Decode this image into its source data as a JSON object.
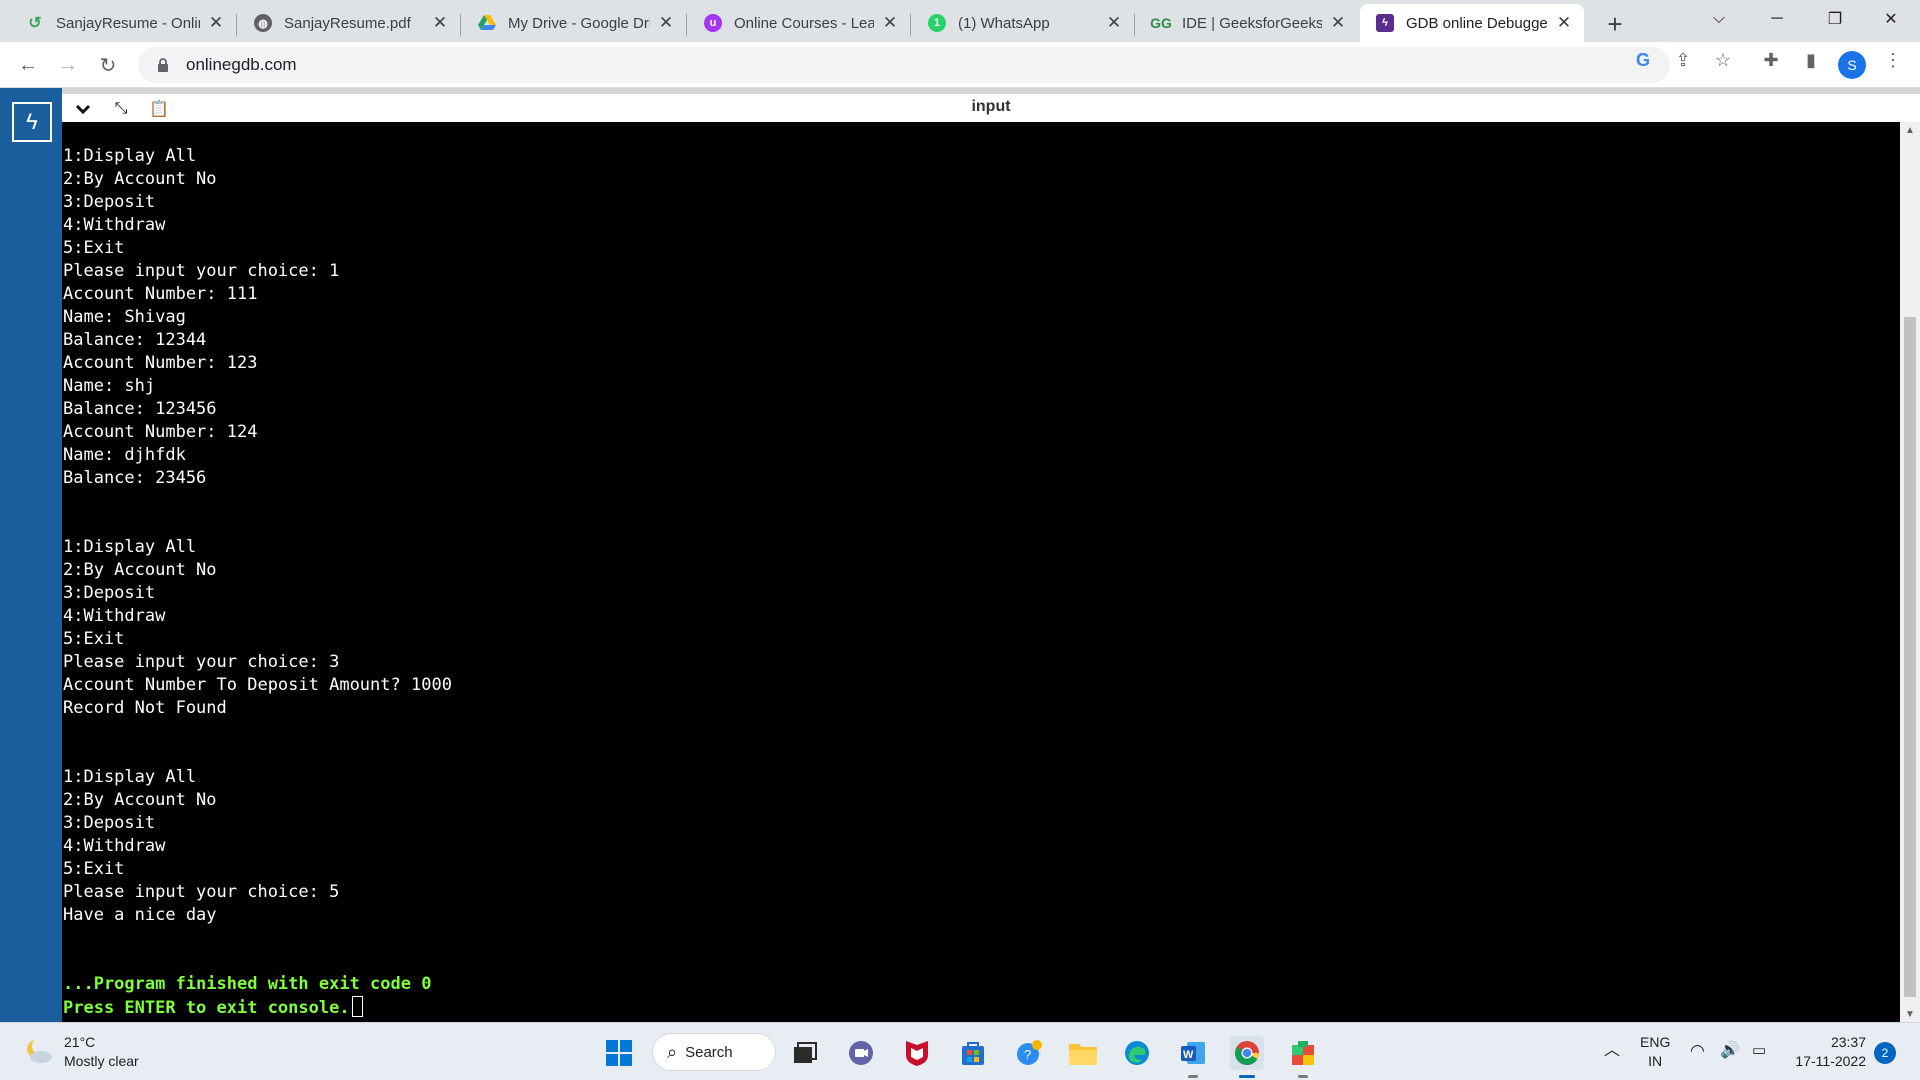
{
  "browser": {
    "tabs": [
      {
        "title": "SanjayResume - Online",
        "icon": "resume-icon",
        "color": "#34a853"
      },
      {
        "title": "SanjayResume.pdf",
        "icon": "globe-icon",
        "color": "#5f6368"
      },
      {
        "title": "My Drive - Google Drive",
        "icon": "google-drive-icon",
        "color": "#fbbc04"
      },
      {
        "title": "Online Courses - Learn",
        "icon": "udemy-icon",
        "color": "#a435f0"
      },
      {
        "title": "(1) WhatsApp",
        "icon": "whatsapp-icon",
        "color": "#25d366"
      },
      {
        "title": "IDE | GeeksforGeeks |",
        "icon": "geeksforgeeks-icon",
        "color": "#2f8d46"
      },
      {
        "title": "GDB online Debugger",
        "icon": "gdb-icon",
        "color": "#5b2d8e"
      }
    ],
    "active_tab": 6,
    "new_tab_label": "+",
    "url": "onlinegdb.com",
    "profile_initial": "S"
  },
  "gdb": {
    "input_panel_title": "input",
    "console_lines": [
      "1:Display All",
      "2:By Account No",
      "3:Deposit",
      "4:Withdraw",
      "5:Exit",
      "Please input your choice: 1",
      "Account Number: 111",
      "Name: Shivag",
      "Balance: 12344",
      "Account Number: 123",
      "Name: shj",
      "Balance: 123456",
      "Account Number: 124",
      "Name: djhfdk",
      "Balance: 23456",
      "",
      "",
      "1:Display All",
      "2:By Account No",
      "3:Deposit",
      "4:Withdraw",
      "5:Exit",
      "Please input your choice: 3",
      "Account Number To Deposit Amount? 1000",
      "Record Not Found",
      "",
      "",
      "1:Display All",
      "2:By Account No",
      "3:Deposit",
      "4:Withdraw",
      "5:Exit",
      "Please input your choice: 5",
      "Have a nice day",
      "",
      ""
    ],
    "finish_line": "...Program finished with exit code 0",
    "exit_prompt": "Press ENTER to exit console.",
    "finish_color": "#7fff3a"
  },
  "taskbar": {
    "weather_temp": "21°C",
    "weather_desc": "Mostly clear",
    "search_label": "Search",
    "apps": [
      "windows-start-icon",
      "search-icon",
      "task-view-icon",
      "teams-chat-icon",
      "mcafee-icon",
      "microsoft-store-icon",
      "app-icon",
      "file-explorer-icon",
      "edge-icon",
      "word-icon",
      "chrome-icon",
      "office-icon"
    ],
    "language_line1": "ENG",
    "language_line2": "IN",
    "time": "23:37",
    "date": "17-11-2022",
    "notification_count": "2"
  }
}
